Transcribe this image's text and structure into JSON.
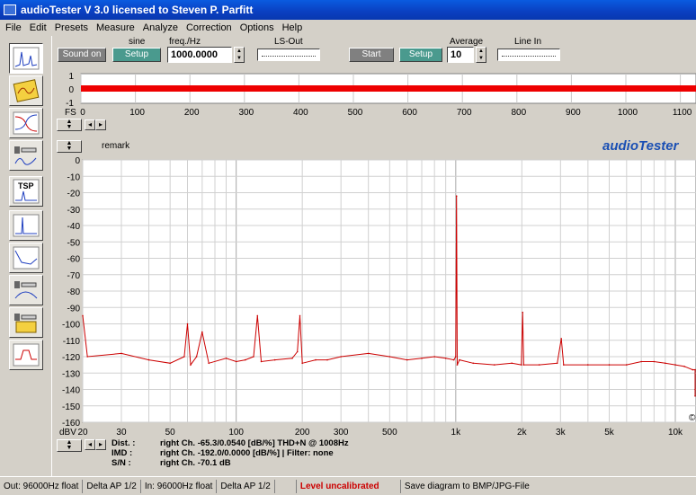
{
  "window": {
    "title": "audioTester  V 3.0   licensed to Steven P. Parfitt"
  },
  "menu": [
    "File",
    "Edit",
    "Presets",
    "Measure",
    "Analyze",
    "Correction",
    "Options",
    "Help"
  ],
  "toolbar": {
    "sine_label": "sine",
    "freq_label": "freq./Hz",
    "lsout_label": "LS-Out",
    "average_label": "Average",
    "linein_label": "Line In",
    "sound_on": "Sound on",
    "setup1": "Setup",
    "freq_value": "1000.0000",
    "start": "Start",
    "setup2": "Setup",
    "average_value": "10"
  },
  "scope": {
    "y_ticks": [
      "1",
      "0",
      "-1"
    ],
    "fs_label": "FS",
    "x_ticks": [
      "0",
      "100",
      "200",
      "300",
      "400",
      "500",
      "600",
      "700",
      "800",
      "900",
      "1000",
      "1100"
    ]
  },
  "spectrum": {
    "remark_label": "remark",
    "brand": "audioTester",
    "unit_label": "dBV",
    "y_ticks": [
      "0",
      "-10",
      "-20",
      "-30",
      "-40",
      "-50",
      "-60",
      "-70",
      "-80",
      "-90",
      "-100",
      "-110",
      "-120",
      "-130",
      "-140",
      "-150",
      "-160"
    ],
    "x_ticks": [
      "20",
      "30",
      "50",
      "100",
      "200",
      "300",
      "500",
      "1k",
      "2k",
      "3k",
      "5k",
      "10k"
    ],
    "corner_mark": "©"
  },
  "chart_data": {
    "type": "line",
    "x_scale": "log",
    "xlim": [
      20,
      15000
    ],
    "ylim": [
      -160,
      0
    ],
    "x_ticks": [
      "20",
      "30",
      "50",
      "100",
      "200",
      "300",
      "500",
      "1k",
      "2k",
      "3k",
      "5k",
      "10k"
    ],
    "ylabel": "dBV",
    "grid": true,
    "series": [
      {
        "x": [
          20,
          21,
          30,
          40,
          50,
          58,
          60,
          62,
          66,
          70,
          75,
          90,
          100,
          110,
          120,
          125,
          130,
          150,
          180,
          190,
          195,
          200,
          230,
          260,
          300,
          400,
          500,
          600,
          700,
          800,
          900,
          980,
          1000,
          1008,
          1016,
          1040,
          1200,
          1500,
          1800,
          1990,
          2016,
          2040,
          2400,
          2900,
          3024,
          3100,
          4000,
          5000,
          6000,
          7000,
          8000,
          9000,
          10000,
          11000,
          12000,
          13000,
          14000,
          15000
        ],
        "y": [
          -95,
          -120,
          -118,
          -122,
          -124,
          -120,
          -100,
          -125,
          -120,
          -105,
          -124,
          -121,
          -123,
          -122,
          -120,
          -95,
          -123,
          -122,
          -121,
          -117,
          -95,
          -124,
          -122,
          -122,
          -120,
          -118,
          -120,
          -122,
          -121,
          -120,
          -121,
          -122,
          -120,
          -22,
          -125,
          -122,
          -124,
          -125,
          -124,
          -125,
          -93,
          -125,
          -125,
          -124,
          -109,
          -125,
          -125,
          -125,
          -125,
          -123,
          -123,
          -124,
          -125,
          -126,
          -128,
          -128,
          -140,
          -144
        ]
      }
    ],
    "text_lines": [
      "Dist. :",
      "right Ch. -65.3/0.0540 [dB/%] THD+N  @ 1008Hz",
      "IMD :",
      "right Ch. -192.0/0.0000 [dB/%]  |   Filter: none",
      "S/N :",
      "right Ch. -70.1 dB"
    ]
  },
  "status": [
    "Out: 96000Hz float",
    "Delta AP 1/2",
    "In: 96000Hz float",
    "Delta AP 1/2",
    "",
    "Level uncalibrated",
    "Save diagram to BMP/JPG-File"
  ],
  "colors": {
    "trace": "#cc0000",
    "status_warn": "#cc0000",
    "brand": "#1a4fb4"
  }
}
